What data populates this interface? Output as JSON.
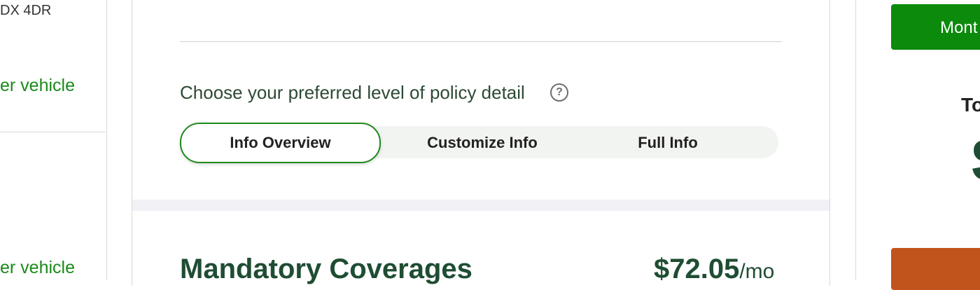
{
  "left": {
    "vehicle_name": "DX 4DR",
    "links": [
      "er vehicle",
      "er vehicle"
    ]
  },
  "policy": {
    "prompt": "Choose your preferred level of policy detail",
    "help_glyph": "?",
    "options": [
      "Info Overview",
      "Customize Info",
      "Full Info"
    ],
    "selected": "Info Overview"
  },
  "section": {
    "title": "Mandatory Coverages",
    "price": "$72.05",
    "price_unit": "/mo"
  },
  "right": {
    "monthly_label": "Mont",
    "total_label": "To",
    "total_amount": "$"
  },
  "colors": {
    "accent_green": "#0b8a0b",
    "dark_green": "#1f4d33",
    "link_green": "#1a8a1a",
    "orange": "#c0541c"
  }
}
